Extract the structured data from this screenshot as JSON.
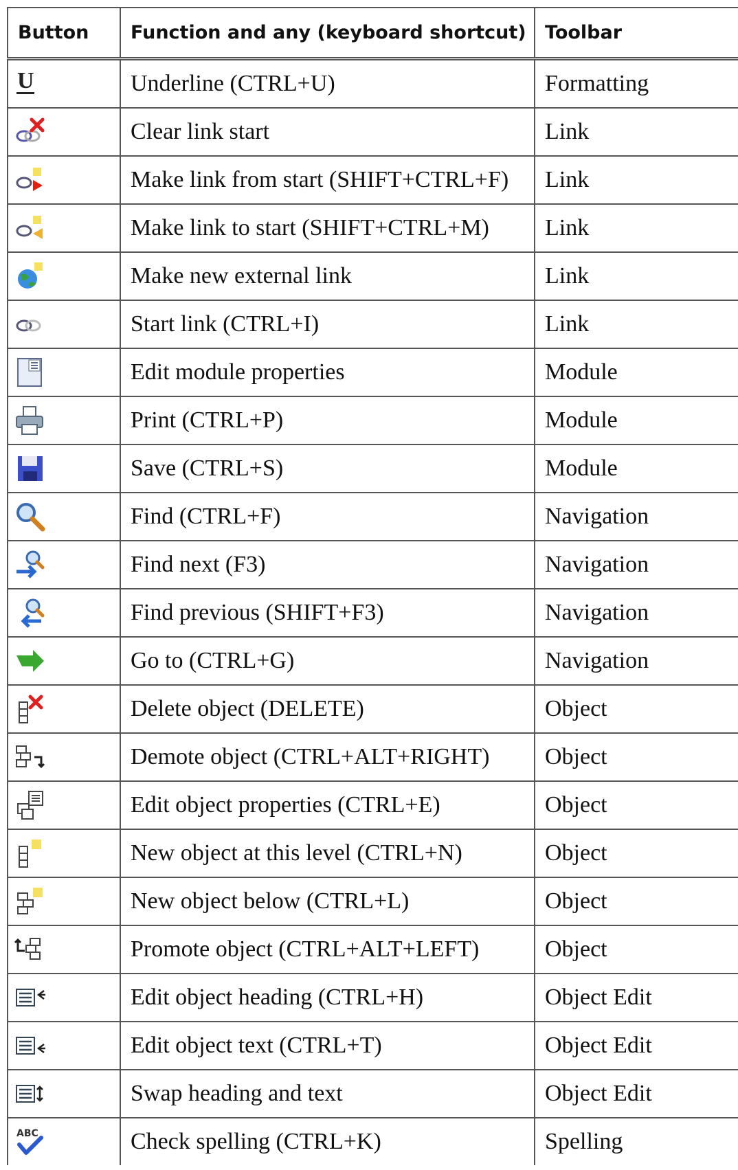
{
  "headers": {
    "button": "Button",
    "function": "Function and any (keyboard shortcut)",
    "toolbar": "Toolbar"
  },
  "rows": [
    {
      "icon": "underline-icon",
      "function": "Underline (CTRL+U)",
      "toolbar": "Formatting"
    },
    {
      "icon": "clear-link-start-icon",
      "function": "Clear link start",
      "toolbar": "Link"
    },
    {
      "icon": "make-link-from-start-icon",
      "function": "Make link from start (SHIFT+CTRL+F)",
      "toolbar": "Link"
    },
    {
      "icon": "make-link-to-start-icon",
      "function": "Make link to start (SHIFT+CTRL+M)",
      "toolbar": "Link"
    },
    {
      "icon": "globe-icon",
      "function": "Make new external link",
      "toolbar": "Link"
    },
    {
      "icon": "start-link-icon",
      "function": "Start link (CTRL+I)",
      "toolbar": "Link"
    },
    {
      "icon": "module-properties-icon",
      "function": "Edit module properties",
      "toolbar": "Module"
    },
    {
      "icon": "printer-icon",
      "function": "Print (CTRL+P)",
      "toolbar": "Module"
    },
    {
      "icon": "floppy-disk-icon",
      "function": "Save (CTRL+S)",
      "toolbar": "Module"
    },
    {
      "icon": "magnifier-icon",
      "function": "Find (CTRL+F)",
      "toolbar": "Navigation"
    },
    {
      "icon": "find-next-icon",
      "function": "Find next (F3)",
      "toolbar": "Navigation"
    },
    {
      "icon": "find-previous-icon",
      "function": "Find previous (SHIFT+F3)",
      "toolbar": "Navigation"
    },
    {
      "icon": "go-to-arrow-icon",
      "function": "Go to (CTRL+G)",
      "toolbar": "Navigation"
    },
    {
      "icon": "delete-object-icon",
      "function": "Delete object (DELETE)",
      "toolbar": "Object"
    },
    {
      "icon": "demote-object-icon",
      "function": "Demote object (CTRL+ALT+RIGHT)",
      "toolbar": "Object"
    },
    {
      "icon": "object-properties-icon",
      "function": "Edit object properties (CTRL+E)",
      "toolbar": "Object"
    },
    {
      "icon": "new-object-same-level-icon",
      "function": "New object at this level (CTRL+N)",
      "toolbar": "Object"
    },
    {
      "icon": "new-object-below-icon",
      "function": "New object below (CTRL+L)",
      "toolbar": "Object"
    },
    {
      "icon": "promote-object-icon",
      "function": "Promote object (CTRL+ALT+LEFT)",
      "toolbar": "Object"
    },
    {
      "icon": "edit-heading-icon",
      "function": "Edit object heading (CTRL+H)",
      "toolbar": "Object Edit"
    },
    {
      "icon": "edit-text-icon",
      "function": "Edit object text (CTRL+T)",
      "toolbar": "Object Edit"
    },
    {
      "icon": "swap-heading-text-icon",
      "function": "Swap heading and text",
      "toolbar": "Object Edit"
    },
    {
      "icon": "spell-check-icon",
      "function": "Check spelling (CTRL+K)",
      "toolbar": "Spelling"
    }
  ]
}
